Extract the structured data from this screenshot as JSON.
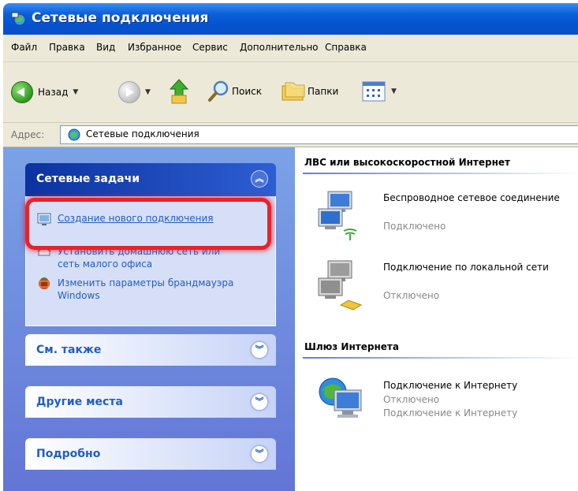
{
  "window": {
    "title": "Сетевые подключения"
  },
  "menu": [
    "Файл",
    "Правка",
    "Вид",
    "Избранное",
    "Сервис",
    "Дополнительно",
    "Справка"
  ],
  "toolbar": {
    "back_label": "Назад",
    "search_label": "Поиск",
    "folders_label": "Папки"
  },
  "address": {
    "label": "Адрес:",
    "value": "Сетевые подключения"
  },
  "left_pane": {
    "network_tasks": {
      "title": "Сетевые задачи",
      "tasks": [
        "Создание нового подключения",
        "Установить домашнюю сеть или сеть малого офиса",
        "Изменить параметры брандмауэра Windows"
      ]
    },
    "see_also": {
      "title": "См. также"
    },
    "other_places": {
      "title": "Другие места"
    },
    "details": {
      "title": "Подробно"
    }
  },
  "right_pane": {
    "lan_group": {
      "title": "ЛВС или высокоскоростной Интернет",
      "items": [
        {
          "name": "Беспроводное сетевое соединение",
          "status": "Подключено"
        },
        {
          "name": "Подключение по локальной сети",
          "status": "Отключено"
        }
      ]
    },
    "gateway_group": {
      "title": "Шлюз Интернета",
      "items": [
        {
          "name": "Подключение к Интернету",
          "status": "Отключено",
          "substatus": "Подключение к Интернету"
        }
      ]
    }
  },
  "colors": {
    "title_bar": "#0553d0",
    "task_pane": "#6f8fe0",
    "link": "#215dc6",
    "highlight": "#e8222a"
  }
}
